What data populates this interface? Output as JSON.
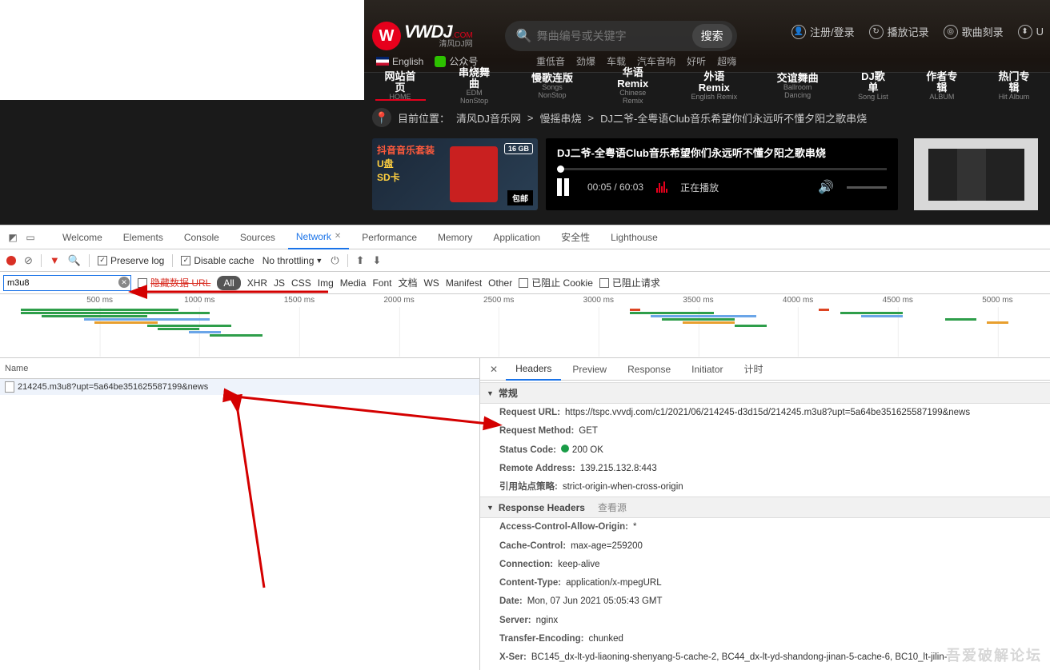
{
  "site": {
    "logo_main": "VWDJ",
    "logo_com": ".COM",
    "logo_sub": "清风DJ网",
    "lang_en": "English",
    "lang_wechat": "公众号",
    "search_placeholder": "舞曲编号或关键字",
    "search_btn": "搜索",
    "toplinks": {
      "login": "注册/登录",
      "history": "播放记录",
      "burn": "歌曲刻录",
      "u": "U"
    },
    "tags": [
      "重低音",
      "劲爆",
      "车载",
      "汽车音响",
      "好听",
      "超嗨"
    ],
    "nav": [
      {
        "cn": "网站首页",
        "en": "HOME"
      },
      {
        "cn": "串烧舞曲",
        "en": "EDM NonStop"
      },
      {
        "cn": "慢歌连版",
        "en": "Songs NonStop"
      },
      {
        "cn": "华语Remix",
        "en": "Chinese Remix"
      },
      {
        "cn": "外语Remix",
        "en": "English Remix"
      },
      {
        "cn": "交谊舞曲",
        "en": "Ballroom Dancing"
      },
      {
        "cn": "DJ歌单",
        "en": "Song List"
      },
      {
        "cn": "作者专辑",
        "en": "ALBUM"
      },
      {
        "cn": "热门专辑",
        "en": "Hit Album"
      }
    ],
    "breadcrumb": {
      "label": "目前位置：",
      "parts": [
        "清风DJ音乐网",
        "慢摇串烧",
        "DJ二爷-全粤语Club音乐希望你们永远听不懂夕阳之歌串烧"
      ]
    },
    "ad": {
      "l1": "抖音音乐套装",
      "l2": "U盘",
      "l3": "SD卡",
      "badge": "16 GB",
      "ship": "包邮"
    },
    "player": {
      "title": "DJ二爷-全粤语Club音乐希望你们永远听不懂夕阳之歌串烧",
      "time": "00:05 / 60:03",
      "status": "正在播放"
    }
  },
  "devtools": {
    "tabs": [
      "Welcome",
      "Elements",
      "Console",
      "Sources",
      "Network",
      "Performance",
      "Memory",
      "Application",
      "安全性",
      "Lighthouse"
    ],
    "active_tab": "Network",
    "toolbar": {
      "preserve": "Preserve log",
      "disable_cache": "Disable cache",
      "throttling": "No throttling"
    },
    "filter": {
      "value": "m3u8",
      "hide_data": "隐藏数据 URL",
      "types": [
        "All",
        "XHR",
        "JS",
        "CSS",
        "Img",
        "Media",
        "Font",
        "文档",
        "WS",
        "Manifest",
        "Other"
      ],
      "blocked_cookies": "已阻止 Cookie",
      "blocked_req": "已阻止请求"
    },
    "timeline_ticks": [
      "500 ms",
      "1000 ms",
      "1500 ms",
      "2000 ms",
      "2500 ms",
      "3000 ms",
      "3500 ms",
      "4000 ms",
      "4500 ms",
      "5000 ms"
    ],
    "request_list": {
      "header": "Name",
      "row": "214245.m3u8?upt=5a64be351625587199&news"
    },
    "detail_tabs": [
      "Headers",
      "Preview",
      "Response",
      "Initiator",
      "计时"
    ],
    "active_detail": "Headers",
    "sections": {
      "general": "常规",
      "response_headers": "Response Headers",
      "view_source": "查看源"
    },
    "general": {
      "url_k": "Request URL:",
      "url_v": "https://tspc.vvvdj.com/c1/2021/06/214245-d3d15d/214245.m3u8?upt=5a64be351625587199&news",
      "method_k": "Request Method:",
      "method_v": "GET",
      "status_k": "Status Code:",
      "status_v": "200 OK",
      "remote_k": "Remote Address:",
      "remote_v": "139.215.132.8:443",
      "referrer_k": "引用站点策略:",
      "referrer_v": "strict-origin-when-cross-origin"
    },
    "response_headers": {
      "acao_k": "Access-Control-Allow-Origin:",
      "acao_v": "*",
      "cc_k": "Cache-Control:",
      "cc_v": "max-age=259200",
      "conn_k": "Connection:",
      "conn_v": "keep-alive",
      "ct_k": "Content-Type:",
      "ct_v": "application/x-mpegURL",
      "date_k": "Date:",
      "date_v": "Mon, 07 Jun 2021 05:05:43 GMT",
      "srv_k": "Server:",
      "srv_v": "nginx",
      "te_k": "Transfer-Encoding:",
      "te_v": "chunked",
      "xser_k": "X-Ser:",
      "xser_v": "BC145_dx-lt-yd-liaoning-shenyang-5-cache-2, BC44_dx-lt-yd-shandong-jinan-5-cache-6, BC10_lt-jilin-"
    }
  },
  "watermark": "吾爱破解论坛"
}
